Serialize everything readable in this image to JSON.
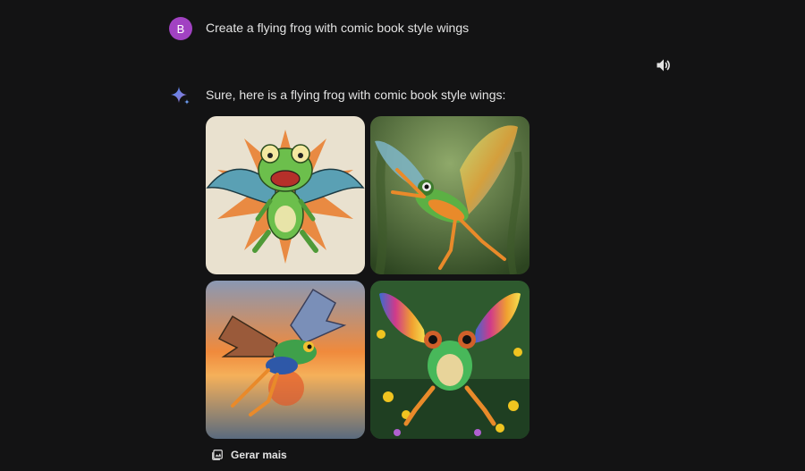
{
  "user": {
    "avatar_letter": "B",
    "prompt": "Create a flying frog with comic book style wings"
  },
  "response": {
    "text": "Sure, here is a flying frog with comic book style wings:"
  },
  "images": [
    {
      "icon": "comic-frog-image"
    },
    {
      "icon": "forest-frog-image"
    },
    {
      "icon": "sunset-frog-image"
    },
    {
      "icon": "flower-frog-image"
    }
  ],
  "actions": {
    "generate_more": "Gerar mais"
  },
  "colors": {
    "background": "#131314",
    "avatar": "#a142c2",
    "text": "#e3e3e3"
  }
}
